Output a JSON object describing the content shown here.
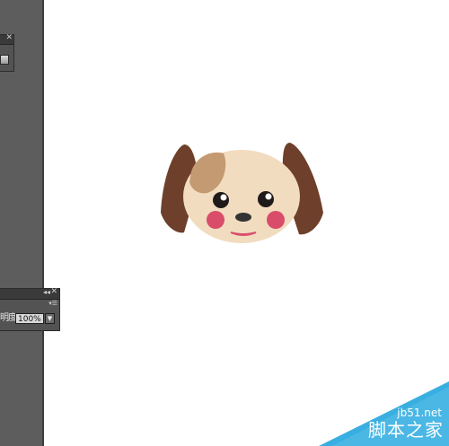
{
  "panel_top": {
    "close_glyph": "✕"
  },
  "panel_bottom": {
    "collapse_glyph": "◂◂",
    "close_glyph": "✕",
    "menu_glyph": "▾☰",
    "opacity_label": "明度",
    "opacity_value": "100%",
    "dropdown_glyph": "▼"
  },
  "illustration": {
    "name": "dog-face",
    "colors": {
      "face": "#f2dcbf",
      "ears": "#6e3f2a",
      "patch": "#c49a72",
      "cheeks": "#d94d6b",
      "eyes": "#1f1a1a",
      "nose": "#333333"
    }
  },
  "watermark": {
    "site": "jb51.net",
    "brand": "脚本之家",
    "color": "#39aee0"
  }
}
